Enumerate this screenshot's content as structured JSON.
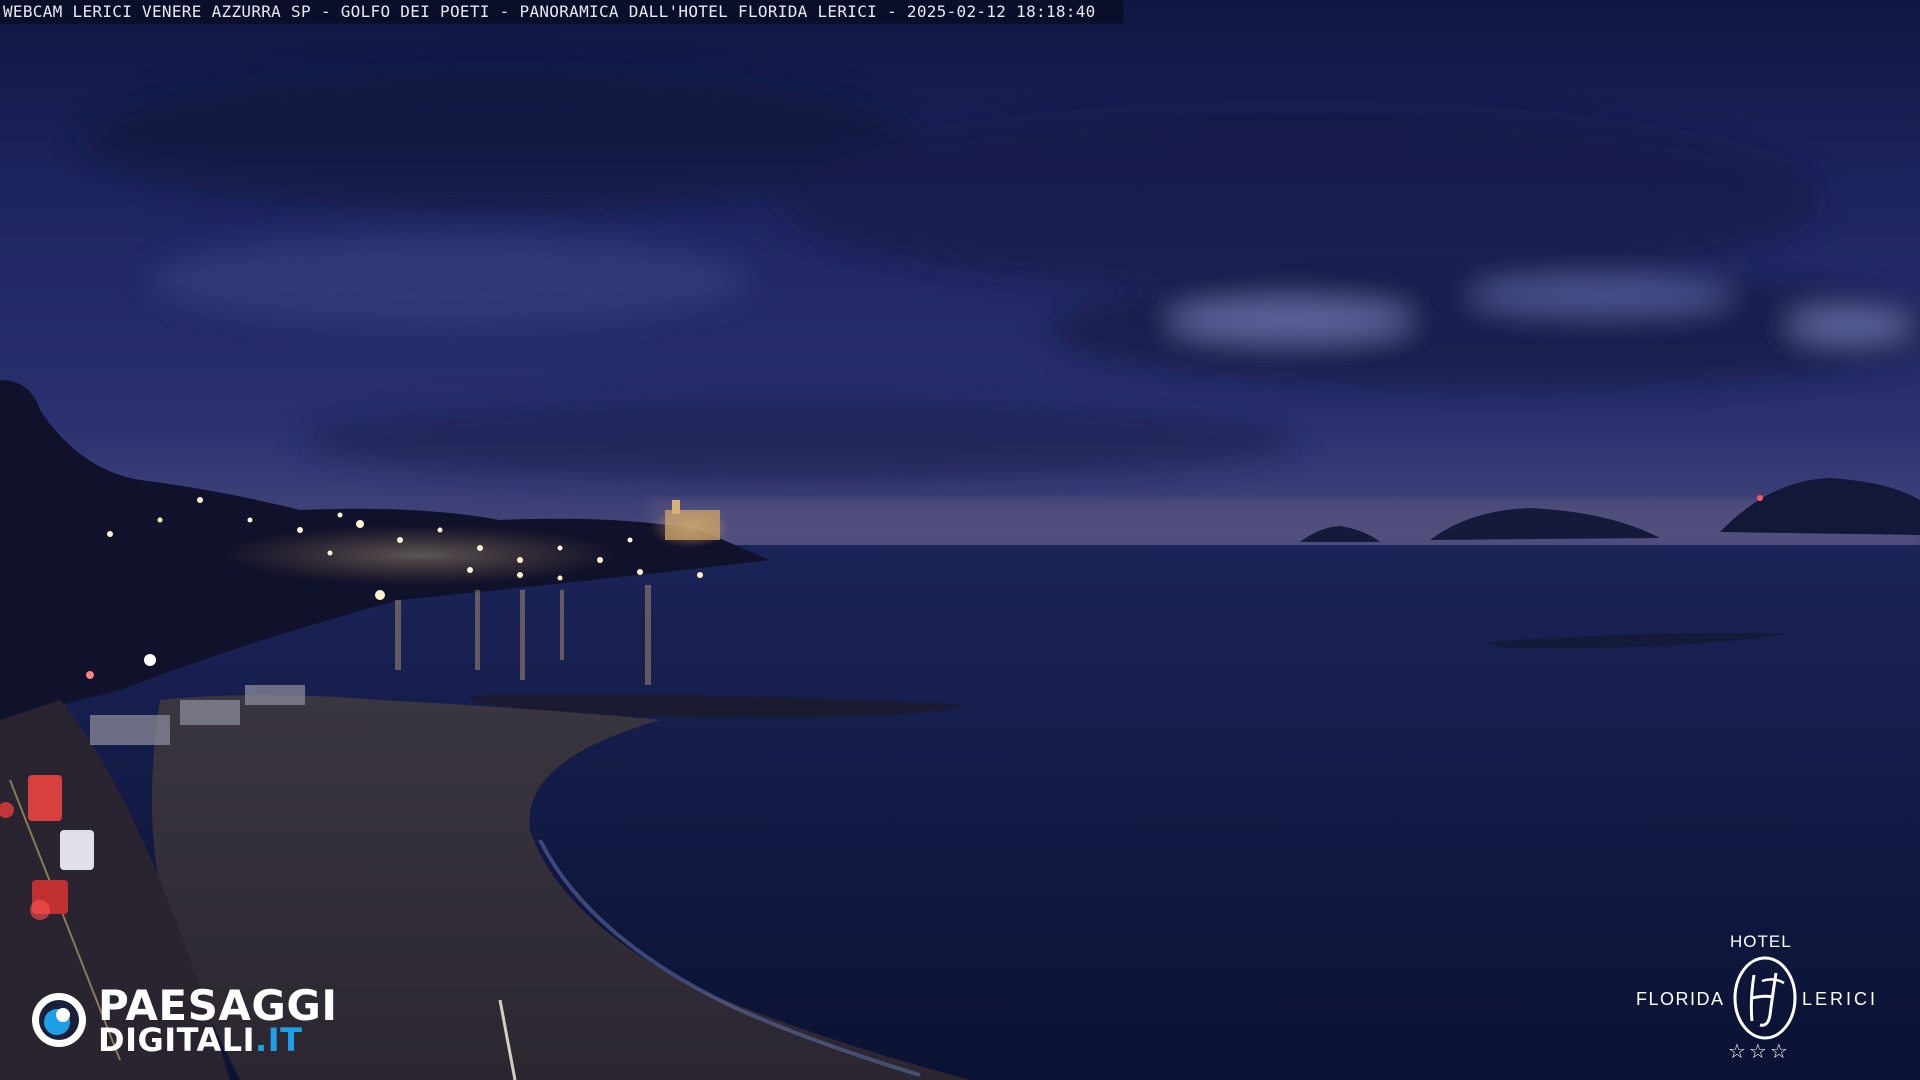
{
  "overlay": {
    "caption": "WEBCAM LERICI VENERE AZZURRA SP - GOLFO DEI POETI - PANORAMICA DALL'HOTEL FLORIDA LERICI - 2025-02-12 18:18:40"
  },
  "logo_left": {
    "line1": "PAESAGGI",
    "line2_main": "DIGITALI",
    "line2_accent": ".IT",
    "accent_color": "#1ea0e8"
  },
  "logo_right": {
    "top": "HOTEL",
    "left": "FLORIDA",
    "right": "LERICI",
    "stars": "☆☆☆",
    "monogram_icon": "hf-monogram-icon"
  },
  "colors": {
    "sky_top": "#141a4a",
    "sky_horizon": "#3a3f78",
    "sea": "#0f1740",
    "beach": "#3a3338"
  }
}
